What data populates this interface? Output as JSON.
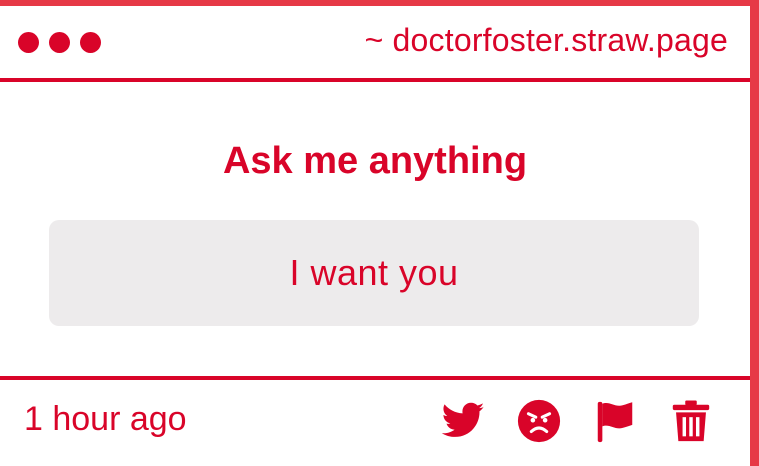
{
  "window": {
    "url": "~ doctorfoster.straw.page"
  },
  "main": {
    "heading": "Ask me anything",
    "message": "I want you"
  },
  "footer": {
    "timestamp": "1 hour ago",
    "actions": [
      "twitter-icon",
      "angry-face-icon",
      "flag-icon",
      "trash-icon"
    ]
  },
  "colors": {
    "accent": "#d90429",
    "frame": "#e63946",
    "message_bg": "#edebec",
    "background": "#ffffff"
  }
}
